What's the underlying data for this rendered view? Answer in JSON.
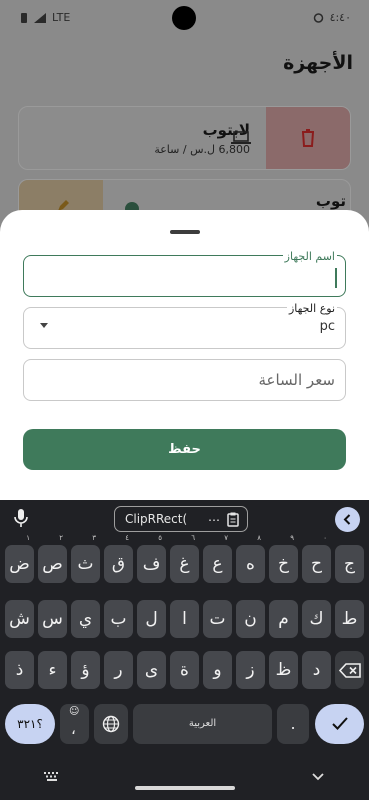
{
  "status": {
    "network": "LTE",
    "time": "٤:٤٠"
  },
  "app": {
    "title": "الأجهزة",
    "devices": [
      {
        "name": "لابتوب",
        "price": "6,800 ل.س / ساعة"
      },
      {
        "name": "توب"
      }
    ]
  },
  "sheet": {
    "name_label": "اسم الجهاز",
    "type_label": "نوع الجهاز",
    "type_value": "pc",
    "price_placeholder": "سعر الساعة",
    "save_label": "حفظ"
  },
  "keyboard": {
    "suggestion": "ClipRRect(",
    "row1": [
      {
        "c": "ج"
      },
      {
        "c": "ح",
        "h": "٠"
      },
      {
        "c": "خ",
        "h": "٩"
      },
      {
        "c": "ه",
        "h": "٨"
      },
      {
        "c": "ع",
        "h": "٧"
      },
      {
        "c": "غ",
        "h": "٦"
      },
      {
        "c": "ف",
        "h": "٥"
      },
      {
        "c": "ق",
        "h": "٤"
      },
      {
        "c": "ث",
        "h": "٣"
      },
      {
        "c": "ص",
        "h": "٢"
      },
      {
        "c": "ض",
        "h": "١"
      }
    ],
    "row2": [
      "ط",
      "ك",
      "م",
      "ن",
      "ت",
      "ا",
      "ل",
      "ب",
      "ي",
      "س",
      "ش"
    ],
    "row3": [
      "د",
      "ظ",
      "ز",
      "و",
      "ة",
      "ى",
      "ر",
      "ؤ",
      "ء",
      "ذ"
    ],
    "numbers_key": "؟٣٢١",
    "comma_key": "،",
    "space_label": "العربية",
    "period_key": "."
  }
}
